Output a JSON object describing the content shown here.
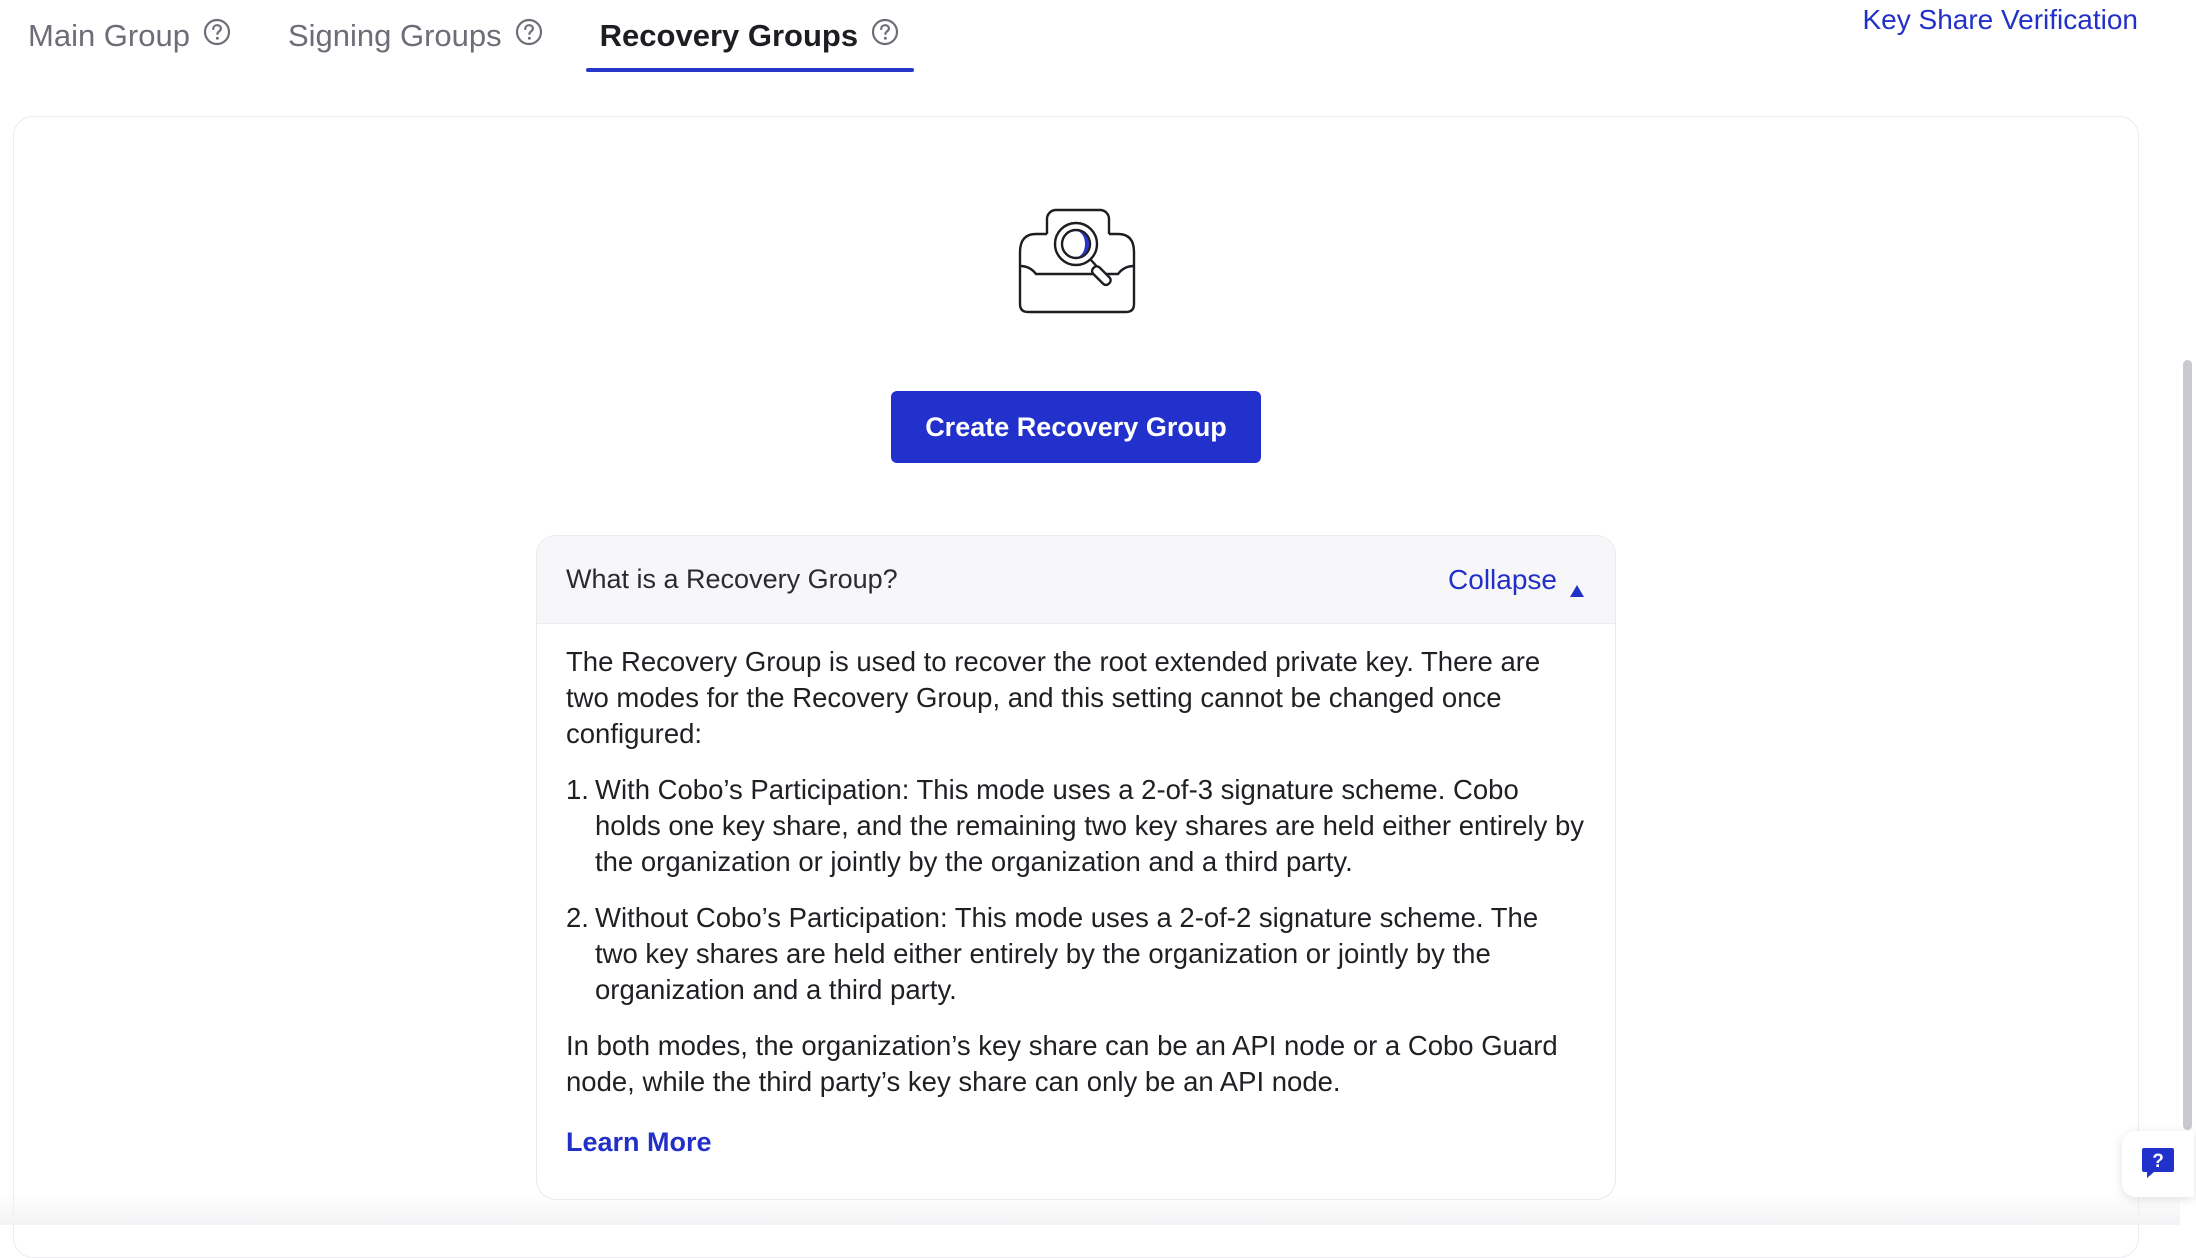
{
  "tabs": [
    {
      "label": "Main Group",
      "icon": "help-circle-icon",
      "active": false
    },
    {
      "label": "Signing Groups",
      "icon": "help-circle-icon",
      "active": false
    },
    {
      "label": "Recovery Groups",
      "icon": "help-circle-icon",
      "active": true
    }
  ],
  "header": {
    "key_share_verification": "Key Share Verification"
  },
  "empty_state": {
    "illustration": "safe-search-icon",
    "create_button": "Create Recovery Group"
  },
  "info": {
    "title": "What is a Recovery Group?",
    "collapse_label": "Collapse",
    "intro": "The Recovery Group is used to recover the root extended private key. There are two modes for the Recovery Group, and this setting cannot be changed once configured:",
    "items": [
      {
        "num": "1.",
        "text": "With Cobo’s Participation: This mode uses a 2-of-3 signature scheme. Cobo holds one key share, and the remaining two key shares are held either entirely by the organization or jointly by the organization and a third party."
      },
      {
        "num": "2.",
        "text": "Without Cobo’s Participation: This mode uses a 2-of-2 signature scheme. The two key shares are held either entirely by the organization or jointly by the organization and a third party."
      }
    ],
    "outro": "In both modes, the organization’s key share can be an API node or a Cobo Guard node, while the third party’s key share can only be an API node.",
    "learn_more": "Learn More"
  },
  "colors": {
    "accent": "#2230cc",
    "link": "#2330c7",
    "text": "#1f1f24",
    "muted": "#6d6d78"
  }
}
